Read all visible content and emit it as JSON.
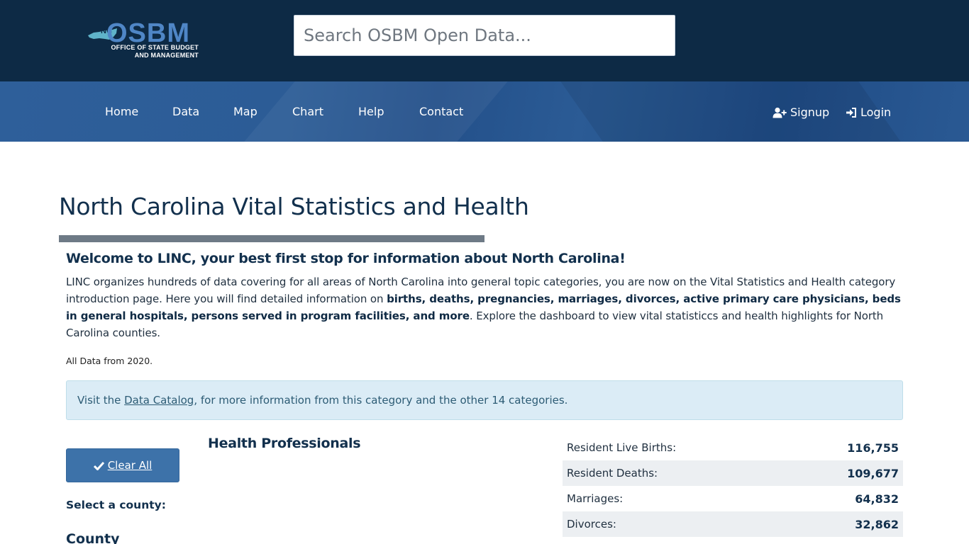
{
  "header": {
    "logo": {
      "abbr": "NC",
      "word": "OSBM",
      "line1": "OFFICE OF STATE BUDGET",
      "line2": "AND MANAGEMENT"
    },
    "search_placeholder": "Search OSBM Open Data..."
  },
  "nav": {
    "items": [
      {
        "label": "Home"
      },
      {
        "label": "Data"
      },
      {
        "label": "Map"
      },
      {
        "label": "Chart"
      },
      {
        "label": "Help"
      },
      {
        "label": "Contact"
      }
    ],
    "signup": "Signup",
    "login": "Login"
  },
  "main": {
    "title": "North Carolina Vital Statistics and Health",
    "welcome": "Welcome to LINC, your best first stop for information about North Carolina!",
    "intro_part1": "LINC organizes hundreds of data covering for all areas of North Carolina into general topic categories, you are now on the Vital Statistics and Health category introduction page. Here you will find detailed information on ",
    "intro_bold": "births, deaths, pregnancies, marriages, divorces, active primary care physicians, beds in general hospitals, persons served in program facilities, and more",
    "intro_part2": ". Explore the dashboard to view vital statisticcs and health highlights for North Carolina counties.",
    "data_year": "All Data from 2020.",
    "alert_prefix": "Visit the ",
    "alert_link": "Data Catalog",
    "alert_suffix": ", for more information from this category and the other 14 categories.",
    "clear_button": "Clear All",
    "select_label": "Select a county:",
    "county_label": "County",
    "section_title": "Health Professionals",
    "stats": [
      {
        "label": "Resident Live Births:",
        "value": "116,755"
      },
      {
        "label": "Resident Deaths:",
        "value": "109,677"
      },
      {
        "label": "Marriages:",
        "value": "64,832"
      },
      {
        "label": "Divorces:",
        "value": "32,862"
      }
    ]
  },
  "colors": {
    "header_bg": "#0d2a45",
    "nav_bg": "#2c5c96",
    "accent": "#3d72a9",
    "alert_bg": "#dbecf6"
  }
}
